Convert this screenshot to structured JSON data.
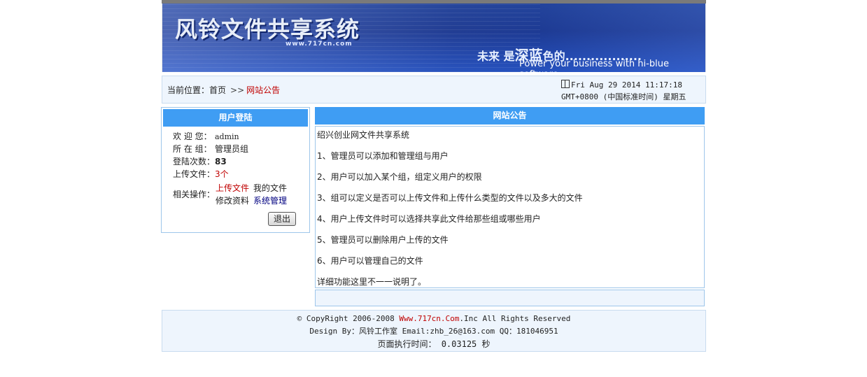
{
  "banner": {
    "title": "风铃文件共享系统",
    "url": "www.717cn.com",
    "slogan_a": "未来 是",
    "slogan_big": "深蓝",
    "slogan_b": "色的..................",
    "slogan_en": "Power your business with hi-blue software"
  },
  "location": {
    "label": "当前位置：",
    "home": "首页",
    "sep": ">>",
    "current": "网站公告",
    "datetime_line1": "Fri Aug 29 2014 11:17:18",
    "datetime_line2": "GMT+0800 (中国标准时间) 星期五"
  },
  "login": {
    "title": "用户登陆",
    "welcome_label": "欢 迎 您：",
    "welcome_value": "admin",
    "group_label": "所 在 组：",
    "group_value": "管理员组",
    "count_label": "登陆次数：",
    "count_value": "83",
    "uploads_label": "上传文件：",
    "uploads_value": "3个",
    "ops_label": "相关操作：",
    "op_upload": "上传文件",
    "op_myfiles": "我的文件",
    "op_profile": "修改资料",
    "op_admin": "系统管理",
    "logout": "退出"
  },
  "notice": {
    "title": "网站公告",
    "lines": [
      "绍兴创业网文件共享系统",
      "1、管理员可以添加和管理组与用户",
      "2、用户可以加入某个组，组定义用户的权限",
      "3、组可以定义是否可以上传文件和上传什么类型的文件以及多大的文件",
      "4、用户上传文件时可以选择共享此文件给那些组或哪些用户",
      "5、管理员可以删除用户上传的文件",
      "6、用户可以管理自己的文件",
      "详细功能这里不一一说明了。"
    ]
  },
  "footer": {
    "copyright_pre": "© CopyRight 2006-2008 ",
    "copyright_link": "Www.717cn.Com",
    "copyright_post": ".Inc All Rights Reserved",
    "design": "Design By：风铃工作室  Email:zhb_26@163.com   QQ：181046951",
    "exec_label": "页面执行时间：",
    "exec_value": " 0.03125 秒"
  },
  "colors": {
    "panel_header": "#3f9df3",
    "link_red": "#c00000",
    "link_navy": "#000080",
    "bar_bg": "#eef5fd"
  }
}
